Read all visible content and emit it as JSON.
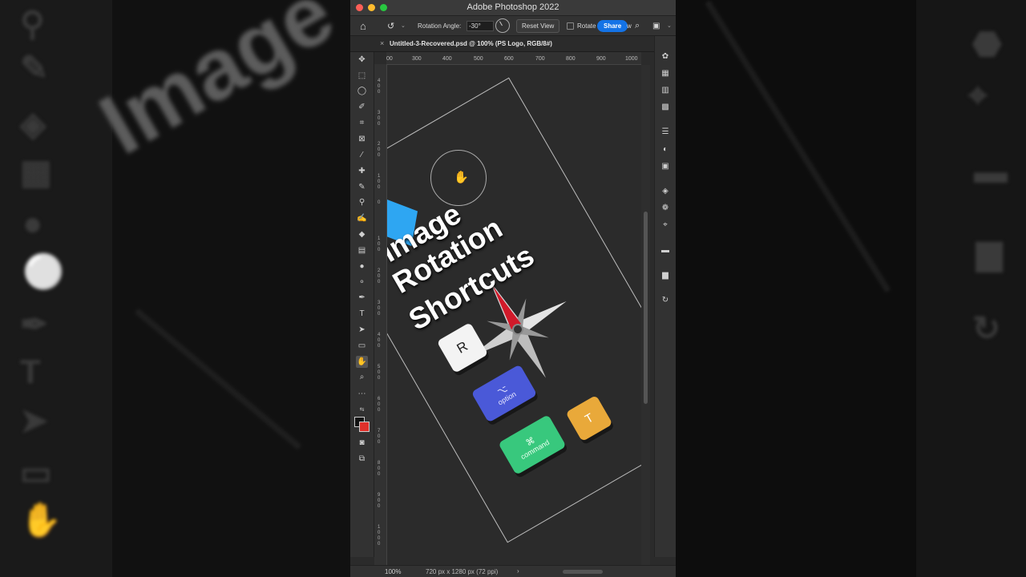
{
  "window": {
    "title": "Adobe Photoshop 2022"
  },
  "options_bar": {
    "rotation_label": "Rotation Angle:",
    "rotation_value": "-30°",
    "reset_view_label": "Reset View",
    "rotate_all_label": "Rotate",
    "share_label": "Share",
    "trailing_label": "w"
  },
  "document_tab": {
    "title": "Untitled-3-Recovered.psd @ 100% (PS Logo, RGB/8#)"
  },
  "ruler_top": {
    "ticks": [
      "00",
      "300",
      "400",
      "500",
      "600",
      "700",
      "800",
      "900",
      "1000"
    ]
  },
  "ruler_left": {
    "ticks": [
      "400",
      "300",
      "200",
      "100",
      "0",
      "100",
      "200",
      "300",
      "400",
      "500",
      "600",
      "700",
      "800",
      "900",
      "1000"
    ]
  },
  "document": {
    "headline_lines": [
      "Image",
      "Rotation",
      "Shortcuts"
    ],
    "keys": {
      "r": "R",
      "option_symbol": "⌥",
      "option_label": "option",
      "command_symbol": "⌘",
      "command_label": "command",
      "t": "T"
    }
  },
  "status_bar": {
    "zoom": "100%",
    "doc_info": "720 px x 1280 px (72 ppi)",
    "arrow": "›"
  },
  "backdrop": {
    "left_text": "Image Rotation Sho"
  },
  "colors": {
    "share_blue": "#1473e6",
    "key_option": "#4a59d8",
    "key_command": "#38c87d",
    "key_t": "#e9a93a",
    "ps_blue": "#2ea6f2"
  }
}
